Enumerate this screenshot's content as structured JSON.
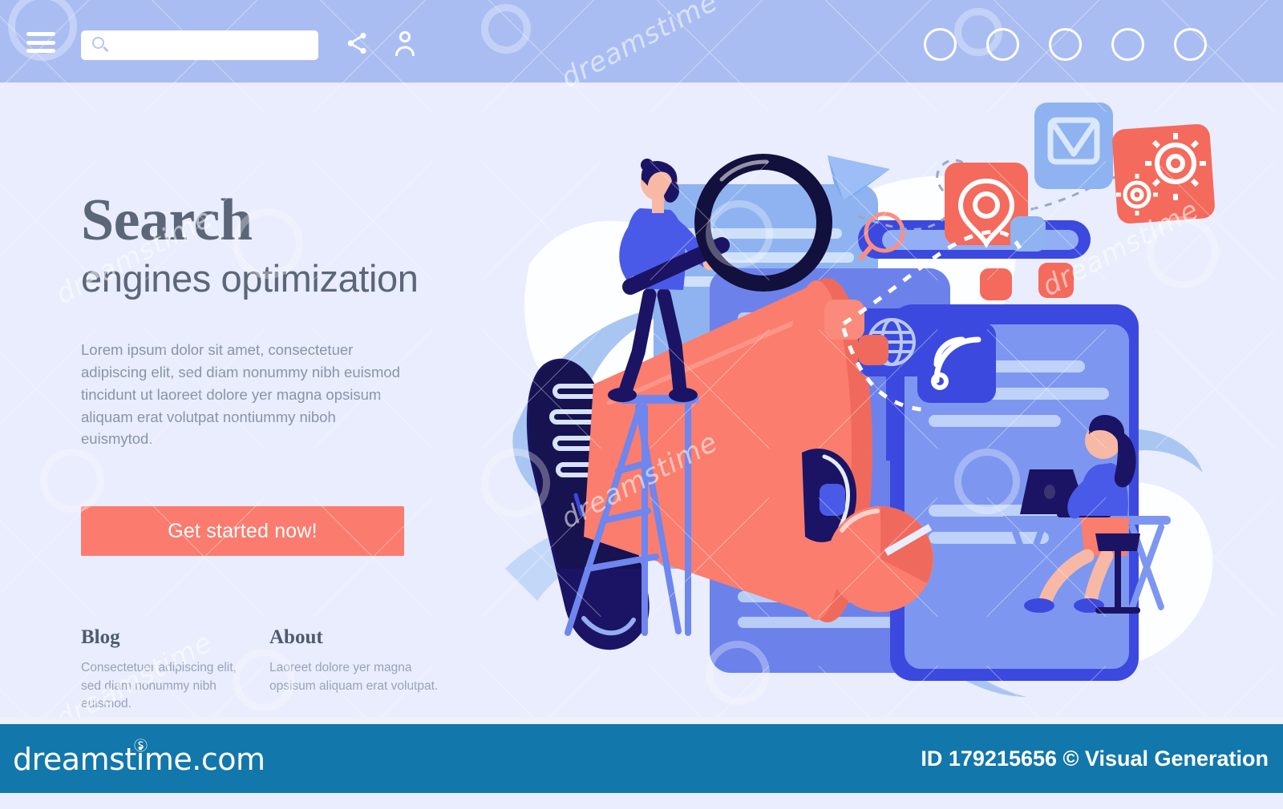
{
  "header": {
    "menu_icon": "hamburger-menu-icon",
    "search": {
      "value": "",
      "placeholder": "",
      "icon": "search-icon"
    },
    "share_icon": "share-icon",
    "account_icon": "user-account-icon",
    "nav_dots": [
      "",
      "",
      "",
      "",
      ""
    ],
    "bg_color": "#aabdf2"
  },
  "hero": {
    "title_serif": "Search",
    "title_sans": "engines optimization",
    "lead": "Lorem ipsum dolor sit amet, consectetuer adipiscing elit, sed diam nonummy nibh euismod tincidunt ut laoreet dolore yer magna opsisum aliquam erat volutpat nontiummy niboh euismytod.",
    "cta_label": "Get started now!",
    "cta_color": "#fb7b6f",
    "text_color": "#5b6679"
  },
  "links": [
    {
      "heading": "Blog",
      "text": "Consectetuer adipiscing elit, sed diam nonummy nibh euismod."
    },
    {
      "heading": "About",
      "text": "Laoreet dolore yer magna opsisum aliquam erat volutpat."
    }
  ],
  "illustration": {
    "name": "seo-megaphone-illustration",
    "elements": [
      "megaphone",
      "man-on-ladder-with-magnifier",
      "document-cards",
      "search-bar-card",
      "mail-tile-icon",
      "gears-tile-icon",
      "location-pin-tile-icon",
      "wifi-tile-icon",
      "globe-tile-icon",
      "pie-chart",
      "paper-plane",
      "woman-at-desk-with-laptop"
    ],
    "colors": {
      "coral": "#fa7d6e",
      "coral_dark": "#ef6a5c",
      "navy": "#1b1464",
      "blue": "#3d49e0",
      "blue_mid": "#5e6fe8",
      "blue_light": "#a8c3f5",
      "blue_pale": "#c5d8fa",
      "white": "#ffffff"
    }
  },
  "footer": {
    "logo": "dreamstime.com",
    "logo_mark": "spiral-registered-icon",
    "credit": "ID 179215656 © Visual Generation",
    "bg_color": "#1277ab"
  },
  "watermark": {
    "word": "dreamstime",
    "mark": "spiral-icon"
  }
}
